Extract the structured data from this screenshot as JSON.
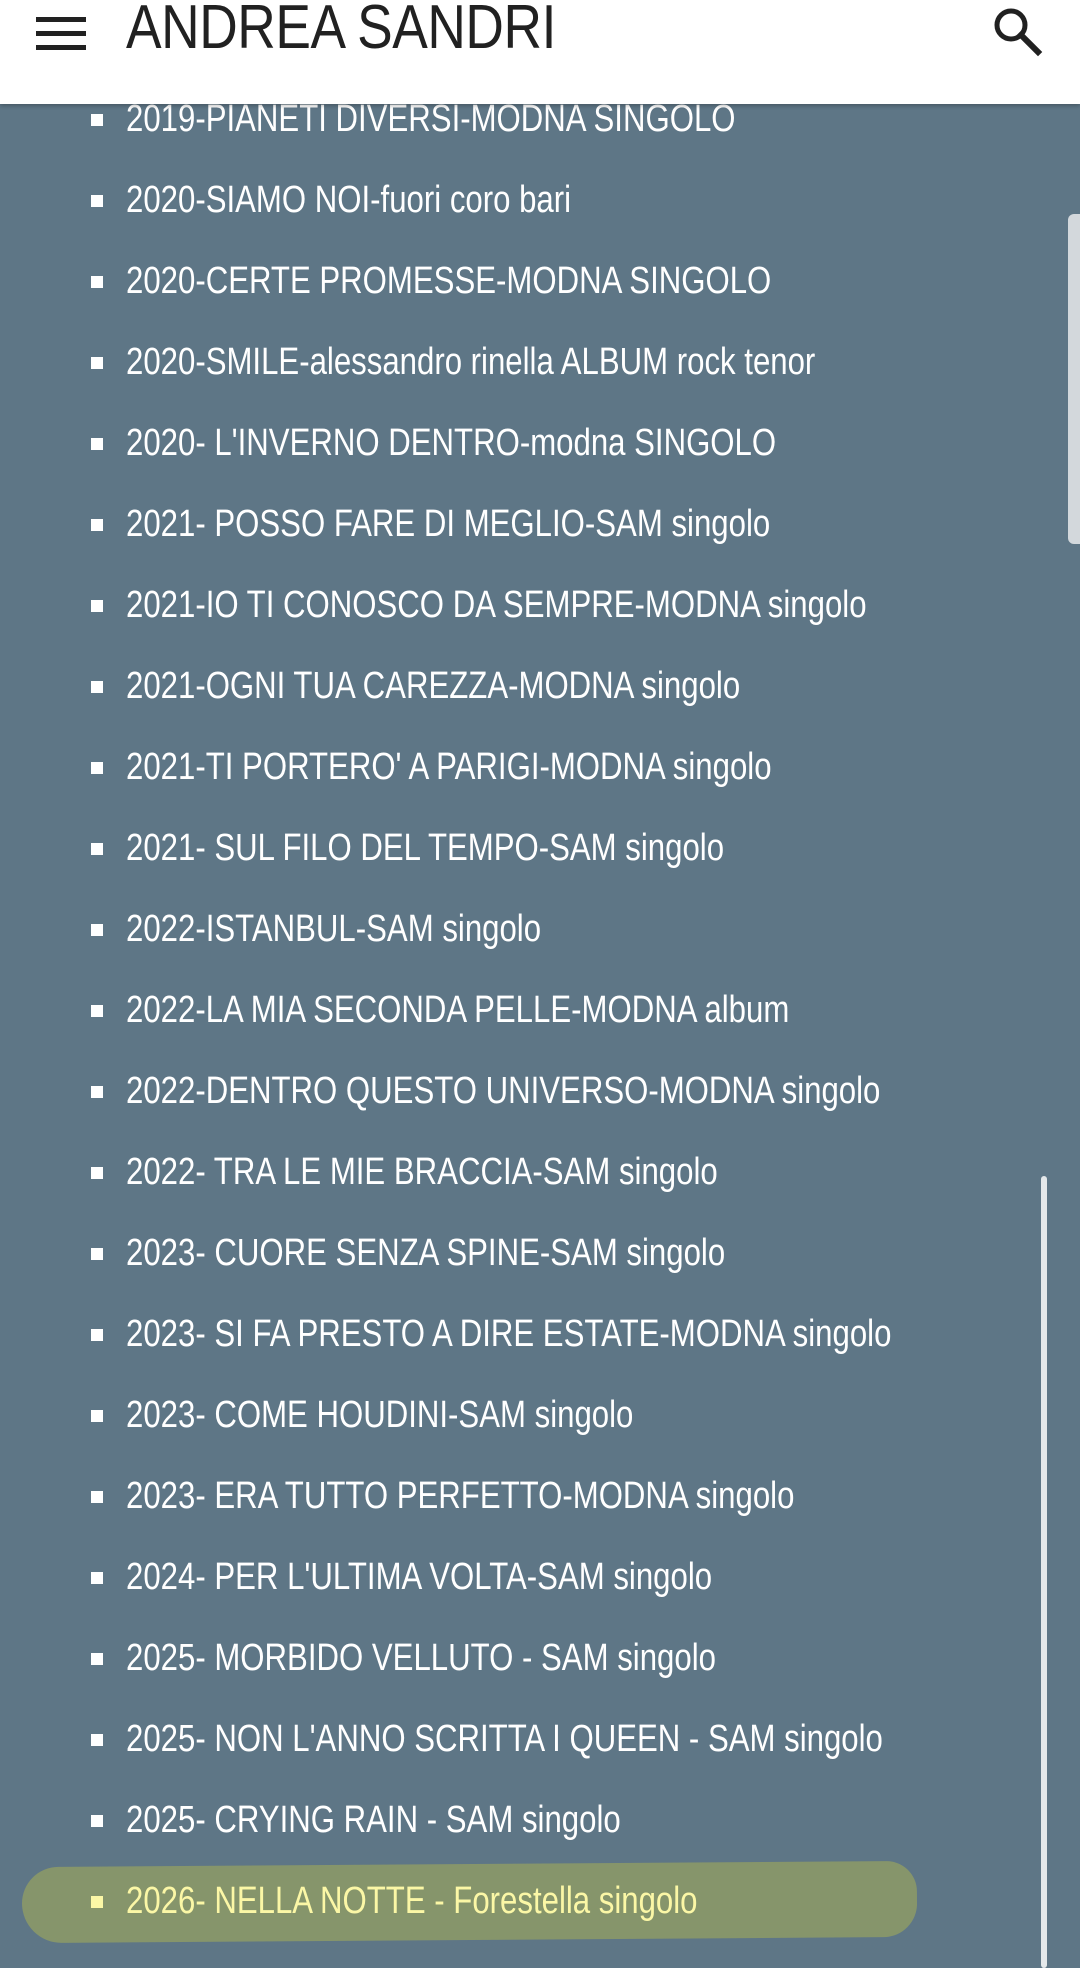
{
  "header": {
    "title": "ANDREA SANDRI",
    "menu_icon": "menu-icon",
    "search_icon": "search-icon"
  },
  "songs": [
    {
      "label": "2019-PIANETI DIVERSI-MODNA SINGOLO"
    },
    {
      "label": "2020-SIAMO NOI-fuori coro bari"
    },
    {
      "label": "2020-CERTE PROMESSE-MODNA SINGOLO"
    },
    {
      "label": "2020-SMILE-alessandro rinella ALBUM rock tenor"
    },
    {
      "label": "2020- L'INVERNO DENTRO-modna SINGOLO"
    },
    {
      "label": "2021- POSSO FARE DI MEGLIO-SAM singolo"
    },
    {
      "label": "2021-IO TI CONOSCO DA SEMPRE-MODNA singolo"
    },
    {
      "label": "2021-OGNI TUA CAREZZA-MODNA singolo"
    },
    {
      "label": "2021-TI PORTERO' A PARIGI-MODNA singolo"
    },
    {
      "label": "2021- SUL FILO DEL TEMPO-SAM singolo"
    },
    {
      "label": "2022-ISTANBUL-SAM singolo"
    },
    {
      "label": "2022-LA MIA SECONDA PELLE-MODNA album"
    },
    {
      "label": "2022-DENTRO QUESTO UNIVERSO-MODNA singolo"
    },
    {
      "label": "2022- TRA LE MIE BRACCIA-SAM singolo"
    },
    {
      "label": "2023- CUORE SENZA SPINE-SAM singolo"
    },
    {
      "label": "2023- SI FA PRESTO A DIRE ESTATE-MODNA singolo"
    },
    {
      "label": "2023- COME HOUDINI-SAM singolo"
    },
    {
      "label": "2023- ERA TUTTO PERFETTO-MODNA singolo"
    },
    {
      "label": "2024- PER L'ULTIMA VOLTA-SAM singolo"
    },
    {
      "label": "2025- MORBIDO VELLUTO - SAM singolo"
    },
    {
      "label": "2025- NON L'ANNO SCRITTA I QUEEN - SAM singolo"
    },
    {
      "label": "2025- CRYING RAIN - SAM singolo"
    },
    {
      "label": "2026- NELLA NOTTE - Forestella singolo",
      "highlighted": true
    }
  ],
  "colors": {
    "background": "#5e7686",
    "header_bg": "#ffffff",
    "text": "#ffffff",
    "highlight_text": "#fbf7a6",
    "highlight_mark": "#86956b"
  }
}
